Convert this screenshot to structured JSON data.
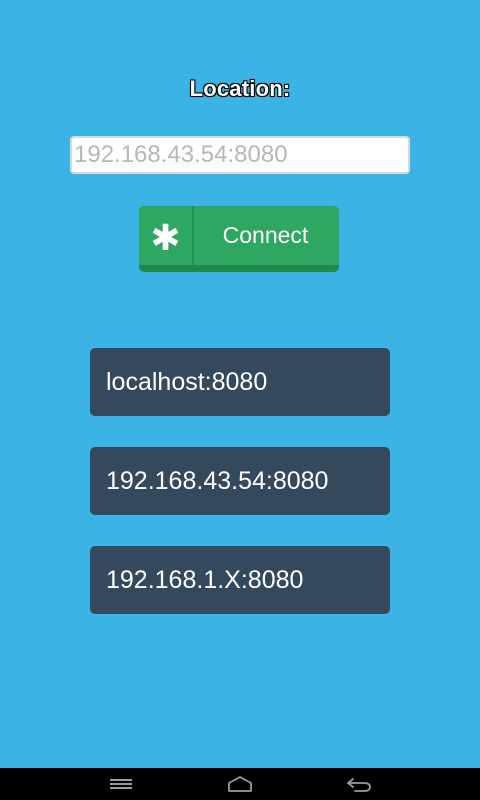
{
  "location": {
    "label": "Location:",
    "placeholder": "192.168.43.54:8080",
    "value": ""
  },
  "connect": {
    "icon": "asterisk-icon",
    "icon_glyph": "✱",
    "label": "Connect"
  },
  "servers": [
    {
      "label": "localhost:8080"
    },
    {
      "label": "192.168.43.54:8080"
    },
    {
      "label": "192.168.1.X:8080"
    }
  ],
  "nav": {
    "menu_icon": "menu-icon",
    "home_icon": "home-icon",
    "back_icon": "back-icon"
  },
  "colors": {
    "background": "#3bb4e5",
    "connect_button": "#2ea761",
    "server_item": "#34495e",
    "nav_bar": "#000000"
  }
}
